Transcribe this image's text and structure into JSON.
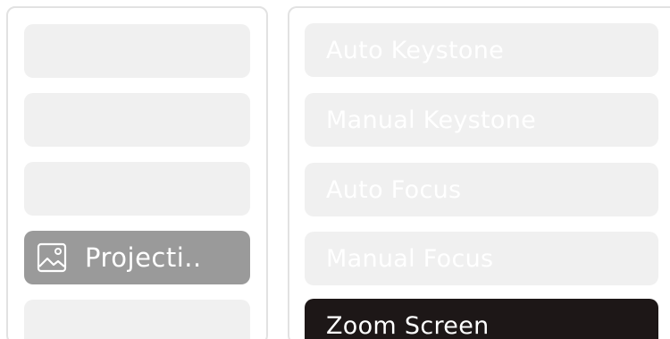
{
  "left_menu": {
    "items": [
      {
        "label": ""
      },
      {
        "label": ""
      },
      {
        "label": ""
      },
      {
        "label": "Projecti..",
        "icon": "image-icon",
        "selected": true
      },
      {
        "label": ""
      }
    ]
  },
  "right_menu": {
    "options": [
      {
        "label": "Auto Keystone"
      },
      {
        "label": "Manual Keystone"
      },
      {
        "label": "Auto Focus"
      },
      {
        "label": "Manual Focus"
      },
      {
        "label": "Zoom Screen",
        "active": true
      }
    ]
  },
  "colors": {
    "tile_bg": "#f0f0f0",
    "selected_bg": "#9a9a9a",
    "active_bg": "#1d1717",
    "panel_border": "#e2e2e2"
  }
}
